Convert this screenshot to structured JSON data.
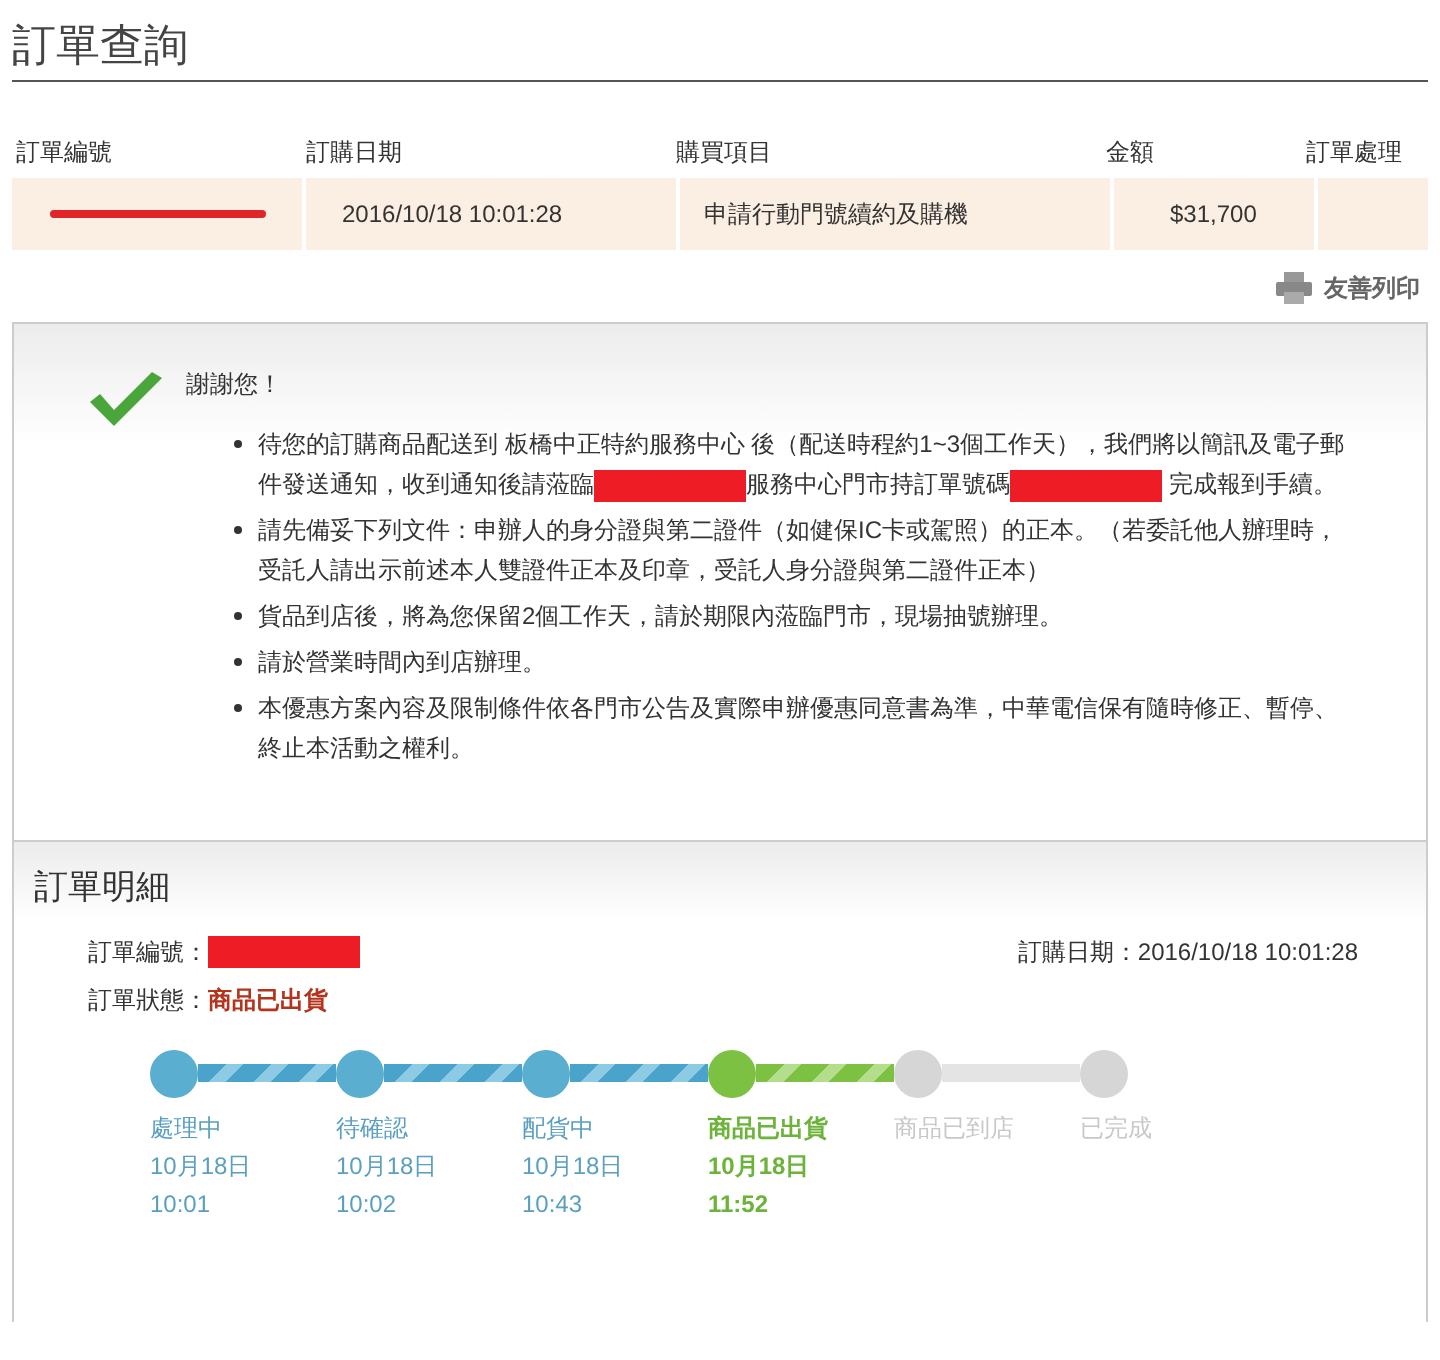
{
  "page_title": "訂單查詢",
  "table": {
    "columns": [
      "訂單編號",
      "訂購日期",
      "購買項目",
      "金額",
      "訂單處理"
    ],
    "rows": [
      {
        "order_no": {
          "kind": "redacted"
        },
        "date": "2016/10/18 10:01:28",
        "item": "申請行動門號續約及購機",
        "amount": "$31,700"
      }
    ]
  },
  "print_link": "友善列印",
  "notice": {
    "title": "謝謝您！",
    "bullets": [
      {
        "parts": [
          {
            "kind": "text",
            "text": "待您的訂購商品配送到 板橋中正特約服務中心 後（配送時程約1~3個工作天），我們將以簡訊及電子郵件發送通知，收到通知後請蒞臨"
          },
          {
            "kind": "redacted"
          },
          {
            "kind": "text",
            "text": "服務中心門市持訂單號碼"
          },
          {
            "kind": "redacted"
          },
          {
            "kind": "text",
            "text": " 完成報到手續。"
          }
        ]
      },
      {
        "parts": [
          {
            "kind": "text",
            "text": "請先備妥下列文件：申辦人的身分證與第二證件（如健保IC卡或駕照）的正本。（若委託他人辦理時，受託人請出示前述本人雙證件正本及印章，受託人身分證與第二證件正本）"
          }
        ]
      },
      {
        "parts": [
          {
            "kind": "text",
            "text": "貨品到店後，將為您保留2個工作天，請於期限內蒞臨門市，現場抽號辦理。"
          }
        ]
      },
      {
        "parts": [
          {
            "kind": "text",
            "text": "請於營業時間內到店辦理。"
          }
        ]
      },
      {
        "parts": [
          {
            "kind": "text",
            "text": "本優惠方案內容及限制條件依各門市公告及實際申辦優惠同意書為準，中華電信保有隨時修正、暫停、終止本活動之權利。"
          }
        ]
      }
    ]
  },
  "detail": {
    "title": "訂單明細",
    "order_no_label": "訂單編號：",
    "order_no": {
      "kind": "redacted"
    },
    "date_label": "訂購日期：",
    "date": "2016/10/18 10:01:28",
    "status_label": "訂單狀態：",
    "status": "商品已出貨",
    "steps": [
      {
        "label": "處理中",
        "date": "10月18日",
        "time": "10:01",
        "kind": "done",
        "level": 1
      },
      {
        "label": "待確認",
        "date": "10月18日",
        "time": "10:02",
        "kind": "done",
        "level": 1
      },
      {
        "label": "配貨中",
        "date": "10月18日",
        "time": "10:43",
        "kind": "done",
        "level": 1
      },
      {
        "label": "商品已出貨",
        "date": "10月18日",
        "time": "11:52",
        "kind": "current",
        "level": 1
      },
      {
        "label": "商品已到店",
        "kind": "pending",
        "level": 0
      },
      {
        "label": "已完成",
        "kind": "pending"
      }
    ]
  }
}
